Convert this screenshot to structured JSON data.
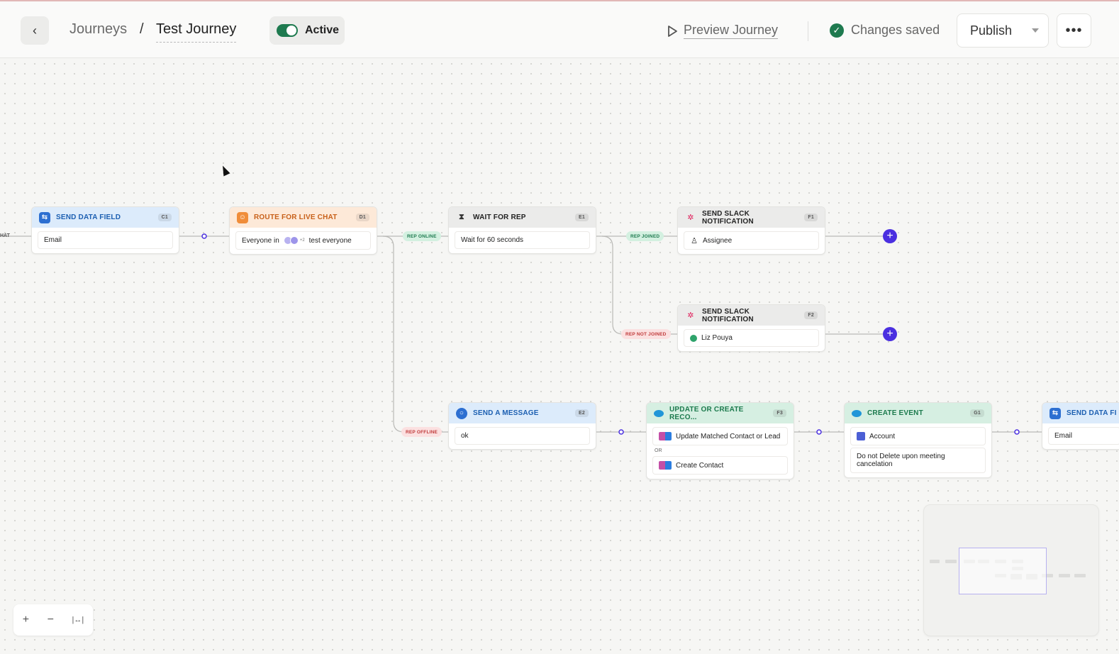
{
  "header": {
    "breadcrumb_root": "Journeys",
    "breadcrumb_sep": "/",
    "breadcrumb_current": "Test Journey",
    "status_label": "Active",
    "preview_label": "Preview Journey",
    "saved_label": "Changes saved",
    "publish_label": "Publish",
    "more_label": "•••"
  },
  "canvas": {
    "edge_stub_label": "HAT",
    "nodes": {
      "c1": {
        "title": "SEND DATA FIELD",
        "code": "C1",
        "field": "Email"
      },
      "d1": {
        "title": "ROUTE FOR LIVE CHAT",
        "code": "D1",
        "field_prefix": "Everyone in",
        "avatar_more": "+2",
        "field_suffix": "test everyone"
      },
      "e1": {
        "title": "WAIT FOR REP",
        "code": "E1",
        "field": "Wait for 60 seconds"
      },
      "f1": {
        "title": "SEND SLACK NOTIFICATION",
        "code": "F1",
        "field": "Assignee"
      },
      "f2": {
        "title": "SEND SLACK NOTIFICATION",
        "code": "F2",
        "field": "Liz Pouya"
      },
      "e2": {
        "title": "SEND A MESSAGE",
        "code": "E2",
        "field": "ok"
      },
      "f3": {
        "title": "UPDATE OR CREATE RECO...",
        "code": "F3",
        "field1": "Update Matched Contact or Lead",
        "or": "OR",
        "field2": "Create Contact"
      },
      "g1": {
        "title": "CREATE EVENT",
        "code": "G1",
        "field1": "Account",
        "field2": "Do not Delete upon meeting cancelation"
      },
      "h1": {
        "title": "SEND DATA FI",
        "field": "Email"
      }
    },
    "edge_labels": {
      "rep_online": "REP ONLINE",
      "rep_joined": "REP JOINED",
      "rep_not_joined": "REP NOT JOINED",
      "rep_offline": "REP OFFLINE"
    }
  },
  "zoom": {
    "in": "+",
    "out": "−",
    "fit": "|↔|"
  },
  "colors": {
    "accent": "#4a2fe0",
    "active_green": "#1e7a4f"
  }
}
